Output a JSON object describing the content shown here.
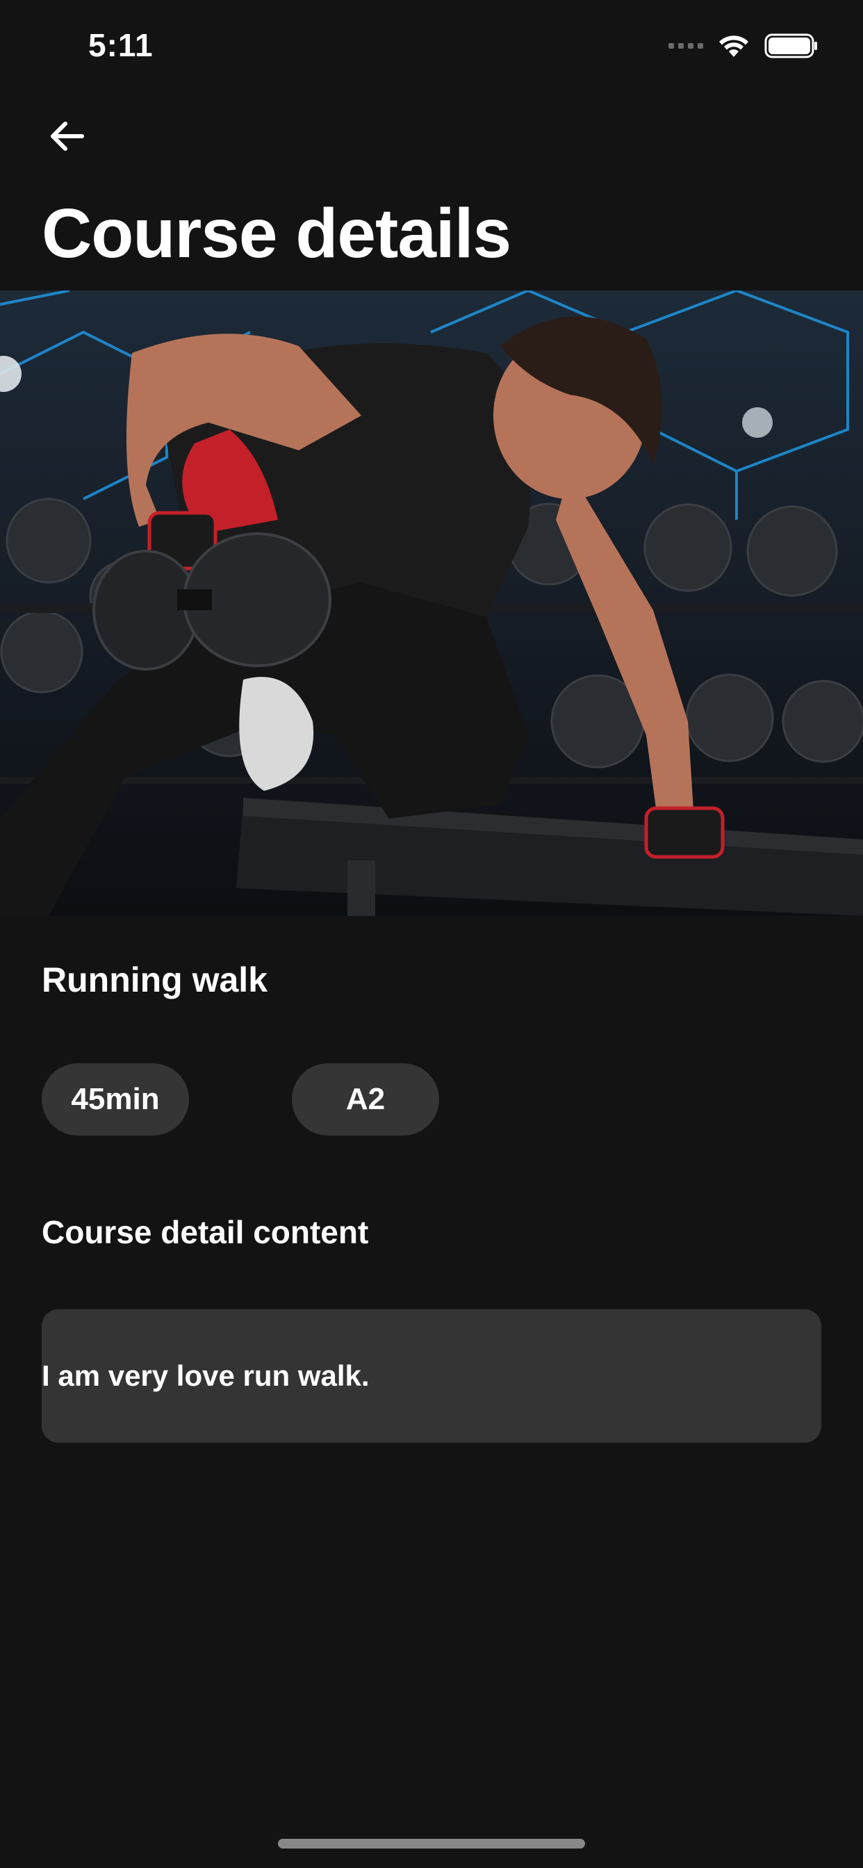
{
  "status_bar": {
    "time": "5:11"
  },
  "header": {
    "title": "Course details"
  },
  "hero": {
    "image_description": "athlete-dumbbell-row"
  },
  "course": {
    "name": "Running walk",
    "duration": "45min",
    "level": "A2"
  },
  "content": {
    "heading": "Course detail content",
    "text": "I am very love run walk."
  },
  "colors": {
    "background": "#131313",
    "chip_bg": "#353535",
    "content_box_bg": "#343434",
    "text": "#ffffff"
  }
}
